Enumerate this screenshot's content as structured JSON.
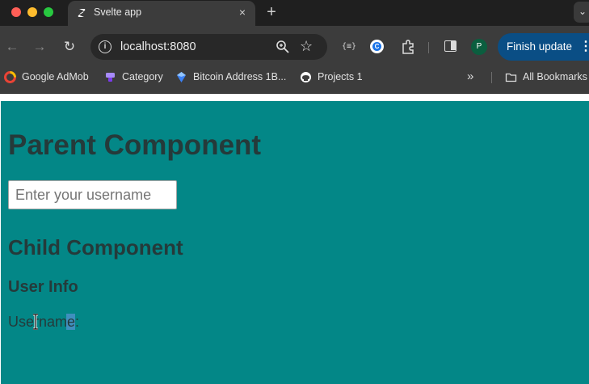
{
  "browser": {
    "tab": {
      "title": "Svelte app",
      "close_icon": "×",
      "favicon": "svelte-icon"
    },
    "new_tab": "+",
    "tab_menu": "⌄",
    "nav": {
      "back": "←",
      "forward": "→",
      "reload": "↻"
    },
    "omnibox": {
      "url": "localhost:8080",
      "site_info": "i",
      "star": "☆"
    },
    "extensions": {
      "json": "{≡}"
    },
    "profile_initial": "P",
    "finish_update": {
      "label": "Finish update",
      "dots": "⋮"
    }
  },
  "bookmarks": {
    "items": [
      {
        "label": "Google AdMob",
        "icon": "admob-icon"
      },
      {
        "label": "Category",
        "icon": "category-icon"
      },
      {
        "label": "Bitcoin Address 1B...",
        "icon": "bitcoin-icon"
      },
      {
        "label": "Projects 1",
        "icon": "github-icon"
      }
    ],
    "more": "»",
    "all_bookmarks": "All Bookmarks"
  },
  "page": {
    "background": "#038787",
    "parent_heading": "Parent Component",
    "username_placeholder": "Enter your username",
    "username_value": "",
    "child_heading": "Child Component",
    "user_info_heading": "User Info",
    "username_label": "Username:"
  }
}
